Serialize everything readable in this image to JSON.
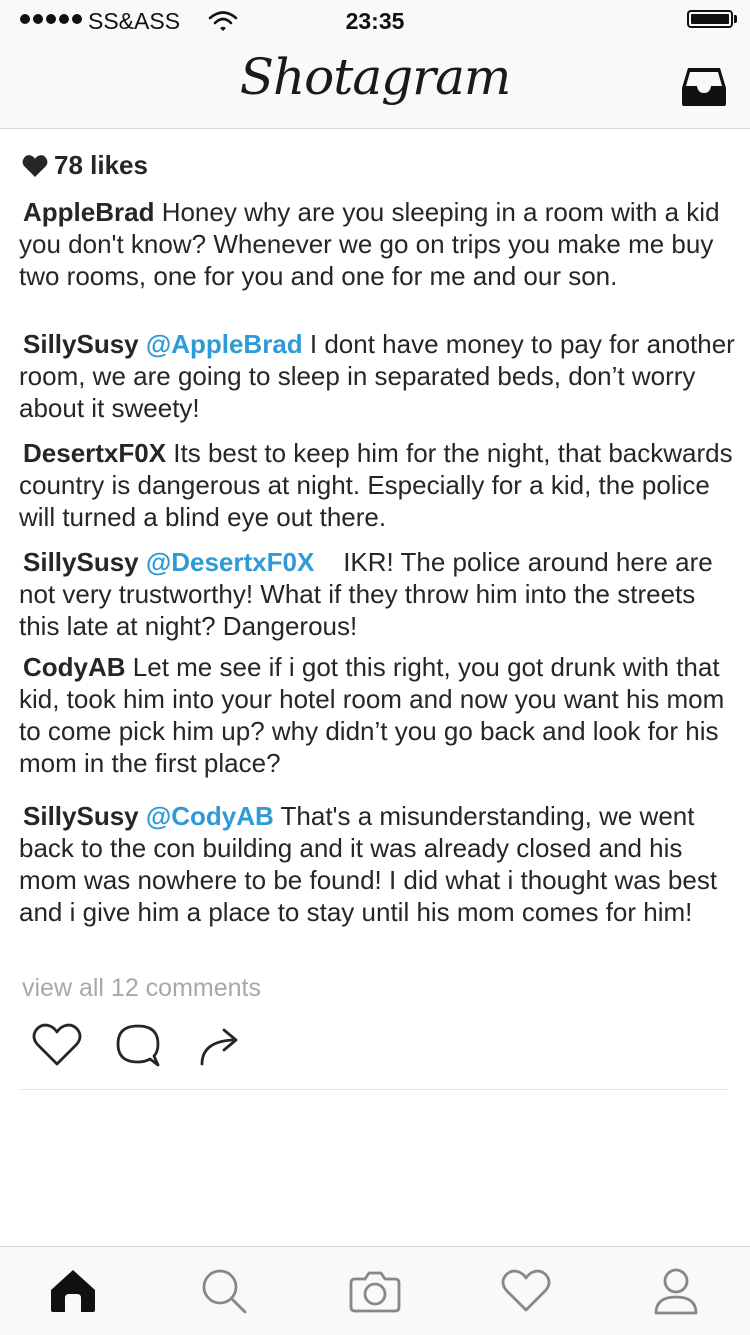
{
  "status_bar": {
    "carrier": "SS&ASS",
    "time": "23:35",
    "battery_level": 1.0
  },
  "header": {
    "logo": "Shotagram",
    "inbox_icon": "inbox-tray-icon"
  },
  "post": {
    "likes": "78 likes",
    "comments": [
      {
        "user": "AppleBrad",
        "mention": "",
        "text": " Honey why are you sleeping in a room with a kid you don't know? Whenever we go on trips you make me buy two rooms, one for you and one for me and our son."
      },
      {
        "user": "SillySusy",
        "mention": "@AppleBrad",
        "text": " I dont have money to pay for another room, we are going to sleep in separated beds, don’t worry about it sweety!"
      },
      {
        "user": "DesertxF0X",
        "mention": "",
        "text": " Its best to keep him for the night, that backwards country is dangerous at night. Especially for a kid, the police will turned a blind eye out there."
      },
      {
        "user": "SillySusy",
        "mention": "@DesertxF0X",
        "text": "    IKR! The police around here are not very trustworthy! What if they throw him into the streets this late at night? Dangerous!"
      },
      {
        "user": "CodyAB",
        "mention": "",
        "text": " Let me see if i got this right, you got drunk with that kid, took him into your hotel room and now you want his mom to come pick him up? why didn’t you go back and look for his mom in the first place?"
      },
      {
        "user": "SillySusy",
        "mention": "@CodyAB",
        "text": " That's a misunderstanding, we went back to the con building and it was already closed and his mom was nowhere to be found! I did what i thought was best and i give him a place to stay until his mom comes for him!"
      }
    ],
    "view_all": "view all 12 comments",
    "actions": [
      "heart-icon",
      "comment-bubble-icon",
      "share-arrow-icon"
    ]
  },
  "tab_bar": {
    "items": [
      "home-icon",
      "search-icon",
      "camera-icon",
      "activity-heart-icon",
      "profile-icon"
    ],
    "active": "home-icon"
  },
  "colors": {
    "mention": "#2e9ad6",
    "text": "#262626",
    "muted": "#a8a8a8",
    "bar_background": "#f9f9f9"
  }
}
